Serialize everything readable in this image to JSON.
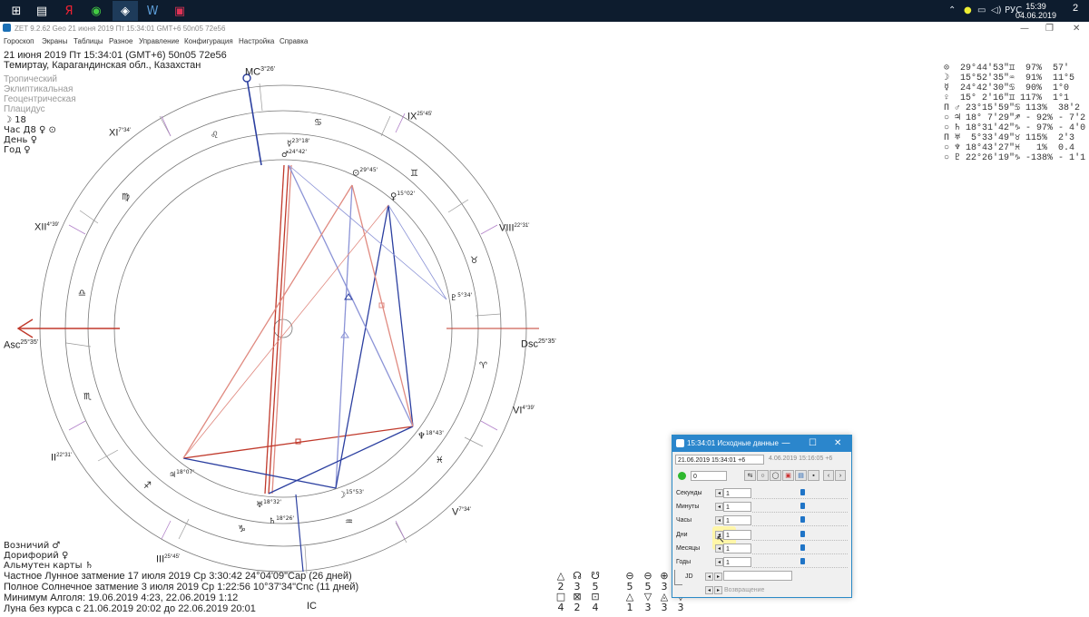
{
  "taskbar": {
    "apps": [
      "windows-icon",
      "task-view-icon",
      "yandex-icon",
      "ccleaner-icon",
      "zet-icon",
      "word-icon",
      "video-editor-icon"
    ],
    "tray_lang": "РУС",
    "time": "15:39",
    "date": "04.06.2019",
    "notifications": "2"
  },
  "window": {
    "title": "ZET 9.2.62 Geo   21 июня 2019  Пт  15:34:01 GMT+6 50n05  72e56"
  },
  "menu": [
    "Гороскоп",
    "Экраны",
    "Таблицы",
    "Разное",
    "Управление",
    "Конфигурация",
    "Настройка",
    "Справка"
  ],
  "header": {
    "line1": "21 июня 2019  Пт  15:34:01 (GMT+6) 50n05  72e56",
    "line2": "Темиртау, Карагандинская обл., Казахстан",
    "settings": [
      "Тропический",
      "Эклиптикальная",
      "Геоцентрическая",
      "Плацидус"
    ],
    "moon_day": "☽ 18",
    "hour": "Час Д8 ♀ ⊙",
    "day": "День ♀",
    "year": "Год ♀"
  },
  "wheel": {
    "mc": "MC",
    "mc_deg": "3°26'",
    "asc": "Asc",
    "asc_deg": "25°35'",
    "dsc": "Dsc",
    "dsc_deg": "25°35'",
    "ic": "IC",
    "houses": [
      {
        "label": "XI",
        "deg": "7°34'"
      },
      {
        "label": "IX",
        "deg": "25°45'"
      },
      {
        "label": "XII",
        "deg": "4°39'"
      },
      {
        "label": "VIII",
        "deg": "22°31'"
      },
      {
        "label": "II",
        "deg": "22°31'"
      },
      {
        "label": "VI",
        "deg": "4°39'"
      },
      {
        "label": "III",
        "deg": "25°45'"
      },
      {
        "label": "V",
        "deg": "7°34'"
      }
    ],
    "planet_labels": [
      {
        "glyph": "☿",
        "deg": "23°18'"
      },
      {
        "glyph": "♂",
        "deg": "24°42'"
      },
      {
        "glyph": "⊙",
        "deg": "29°45'"
      },
      {
        "glyph": "♀",
        "deg": "15°02'"
      },
      {
        "glyph": "♇",
        "deg": "5°34'"
      },
      {
        "glyph": "♆",
        "deg": "18°43'"
      },
      {
        "glyph": "☽",
        "deg": "15°53'"
      },
      {
        "glyph": "♅",
        "deg": "18°32'"
      },
      {
        "glyph": "♃",
        "deg": "18°07'"
      },
      {
        "glyph": "♄",
        "deg": "18°26'"
      }
    ],
    "signs": [
      "♋",
      "♌",
      "♊",
      "♍",
      "♉",
      "♎",
      "♈",
      "♏",
      "♓",
      "♐",
      "♒",
      "♑"
    ]
  },
  "planets_table": [
    "⊙  29°44'53\"♊  97%  57'",
    "☽  15°52'35\"♒  91%  11°5",
    "☿  24°42'30\"♋  90%  1°0",
    "♀  15° 2'16\"♊ 117%  1°1",
    "Π ♂ 23°15'59\"♋ 113%  38'2",
    "○ ♃ 18° 7'29\"♐ - 92% - 7'2",
    "○ ♄ 18°31'42\"♑ - 97% - 4'0",
    "Π ♅  5°33'49\"♉ 115%  2'3",
    "○ ♆ 18°43'27\"♓   1%  0.4",
    "○ ♇ 22°26'19\"♑ -138% - 1'1"
  ],
  "footer": {
    "lines": [
      "Возничий ♂",
      "Дорифорий ♀",
      "Альмутен карты ♄",
      "Частное Лунное затмение 17 июля 2019 Ср  3:30:42 24°04'09\"Cap (26 дней)",
      "Полное Солнечное затмение 3 июля 2019 Ср  1:22:56 10°37'34\"Cnc (11 дней)",
      "Минимум Алголя: 19.06.2019  4:23,  22.06.2019  1:12",
      "Луна без курса с 21.06.2019 20:02 до 22.06.2019 20:01"
    ]
  },
  "aspects": {
    "row0": [
      "△",
      "☊",
      "☋",
      "",
      "⊖",
      "⊖",
      "⊕"
    ],
    "row1": [
      "2",
      "3",
      "5",
      "",
      "5",
      "5",
      "3"
    ],
    "row2": [
      "□",
      "⊠",
      "⊡",
      "",
      "△",
      "▽",
      "◬",
      "▽"
    ],
    "row3": [
      "4",
      "2",
      "4",
      "",
      "1",
      "3",
      "3",
      "3"
    ]
  },
  "dialog": {
    "title": "15:34:01 Исходные данные",
    "datetime": "21.06.2019  15:34:01  +6",
    "ref": "4.06.2019  15:16:05  +6",
    "counter": "0",
    "rows": [
      {
        "label": "Секунды",
        "value": "1",
        "level": 0.5
      },
      {
        "label": "Минуты",
        "value": "1",
        "level": 0.5
      },
      {
        "label": "Часы",
        "value": "1",
        "level": 0.5
      },
      {
        "label": "Дни",
        "value": "1",
        "level": 0.5
      },
      {
        "label": "Месяцы",
        "value": "1",
        "level": 0.5
      },
      {
        "label": "Годы",
        "value": "1",
        "level": 0.5
      }
    ],
    "jd_label": "JD",
    "return_label": "Возвращение"
  },
  "colors": {
    "red_line": "#c0392b",
    "blue_line": "#2b3fa0",
    "light_red": "#e08a80",
    "light_blue": "#8b93d6",
    "accent": "#2b86cc"
  }
}
